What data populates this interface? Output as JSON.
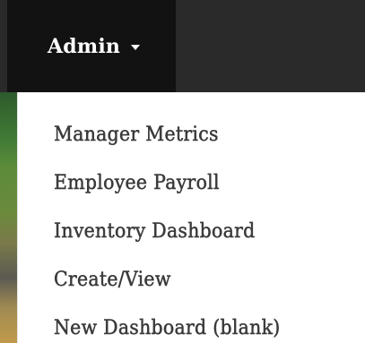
{
  "navbar": {
    "admin_label": "Admin",
    "caret_icon": "caret-down-icon",
    "background_color": "#2a2a2a",
    "active_color": "#121212"
  },
  "dropdown": {
    "items": [
      {
        "label": "Manager Metrics"
      },
      {
        "label": "Employee Payroll"
      },
      {
        "label": "Inventory Dashboard"
      },
      {
        "label": "Create/View"
      },
      {
        "label": "New Dashboard (blank)"
      }
    ],
    "text_color": "#3a3a3a"
  }
}
